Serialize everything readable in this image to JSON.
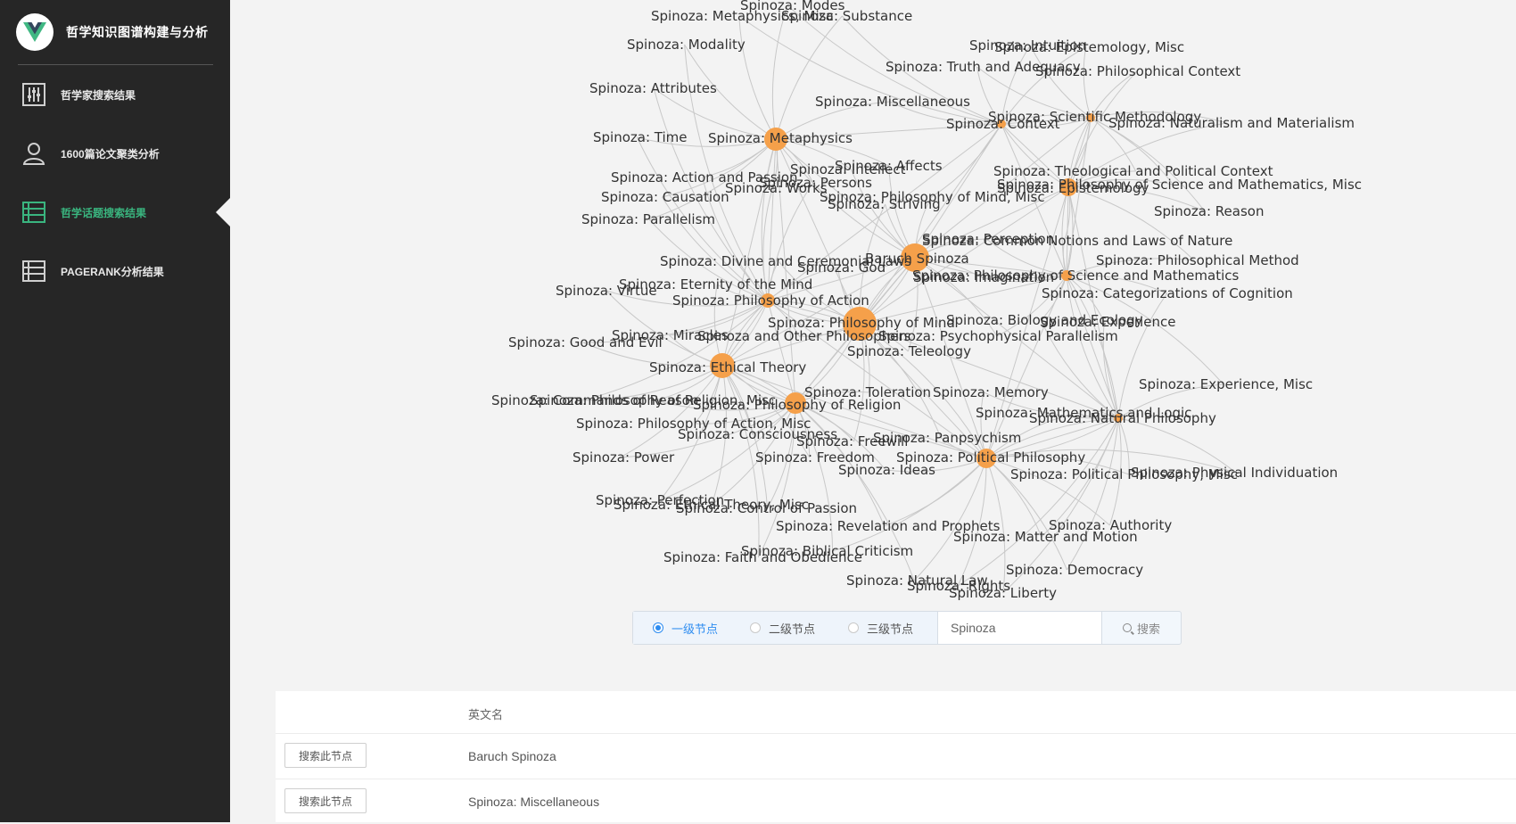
{
  "sidebar": {
    "brand_title": "哲学知识图谱构建与分析",
    "items": [
      {
        "label": "哲学家搜索结果",
        "icon": "sliders-icon",
        "active": false
      },
      {
        "label": "1600篇论文聚类分析",
        "icon": "user-icon",
        "active": false
      },
      {
        "label": "哲学话题搜索结果",
        "icon": "list-icon",
        "active": true
      },
      {
        "label": "PAGERANK分析结果",
        "icon": "list-icon",
        "active": false
      }
    ]
  },
  "colors": {
    "node": "#f5a04a",
    "edge": "#c8c8c8",
    "sidebar_bg": "#262626",
    "active": "#3ab57f",
    "radio_accent": "#2d8cf0"
  },
  "graph": {
    "nodes": [
      {
        "label": "Spinoza: Modes"
      },
      {
        "label": "Spinoza: Metaphysics, Misc"
      },
      {
        "label": "Spinoza: Substance"
      },
      {
        "label": "Spinoza: Modality"
      },
      {
        "label": "Spinoza: Intuition"
      },
      {
        "label": "Spinoza: Epistemology, Misc"
      },
      {
        "label": "Spinoza: Truth and Adequacy"
      },
      {
        "label": "Spinoza: Philosophical Context"
      },
      {
        "label": "Spinoza: Attributes"
      },
      {
        "label": "Spinoza: Miscellaneous"
      },
      {
        "label": "Spinoza: Scientific Methodology"
      },
      {
        "label": "Spinoza: Context"
      },
      {
        "label": "Spinoza: Naturalism and Materialism"
      },
      {
        "label": "Spinoza: Time"
      },
      {
        "label": "Spinoza: Metaphysics"
      },
      {
        "label": "Spinoza: Affects"
      },
      {
        "label": "Spinoza: Intellect"
      },
      {
        "label": "Spinoza: Theological and Political Context"
      },
      {
        "label": "Spinoza: Action and Passion"
      },
      {
        "label": "Spinoza: Persons"
      },
      {
        "label": "Spinoza: Philosophy of Science and Mathematics, Misc"
      },
      {
        "label": "Spinoza: Works"
      },
      {
        "label": "Spinoza: Epistemology"
      },
      {
        "label": "Spinoza: Causation"
      },
      {
        "label": "Spinoza: Philosophy of Mind, Misc"
      },
      {
        "label": "Spinoza: Striving"
      },
      {
        "label": "Spinoza: Reason"
      },
      {
        "label": "Spinoza: Parallelism"
      },
      {
        "label": "Spinoza: Perception"
      },
      {
        "label": "Spinoza: Common Notions and Laws of Nature"
      },
      {
        "label": "Spinoza: Divine and Ceremonial Laws"
      },
      {
        "label": "Baruch Spinoza"
      },
      {
        "label": "Spinoza: Philosophical Method"
      },
      {
        "label": "Spinoza: God"
      },
      {
        "label": "Spinoza: Philosophy of Science and Mathematics"
      },
      {
        "label": "Spinoza: Imagination"
      },
      {
        "label": "Spinoza: Eternity of the Mind"
      },
      {
        "label": "Spinoza: Virtue"
      },
      {
        "label": "Spinoza: Categorizations of Cognition"
      },
      {
        "label": "Spinoza: Philosophy of Action"
      },
      {
        "label": "Spinoza: Philosophy of Mind"
      },
      {
        "label": "Spinoza: Biology and Ecology"
      },
      {
        "label": "Spinoza: Experience"
      },
      {
        "label": "Spinoza: Miracles"
      },
      {
        "label": "Spinoza and Other Philosophers"
      },
      {
        "label": "Spinoza: Psychophysical Parallelism"
      },
      {
        "label": "Spinoza: Good and Evil"
      },
      {
        "label": "Spinoza: Teleology"
      },
      {
        "label": "Spinoza: Ethical Theory"
      },
      {
        "label": "Spinoza: Experience, Misc"
      },
      {
        "label": "Spinoza: Toleration"
      },
      {
        "label": "Spinoza: Memory"
      },
      {
        "label": "Spinoza: Commands of Reason"
      },
      {
        "label": "Spinoza: Philosophy of Religion, Misc"
      },
      {
        "label": "Spinoza: Philosophy of Religion"
      },
      {
        "label": "Spinoza: Mathematics and Logic"
      },
      {
        "label": "Spinoza: Natural Philosophy"
      },
      {
        "label": "Spinoza: Philosophy of Action, Misc"
      },
      {
        "label": "Spinoza: Consciousness"
      },
      {
        "label": "Spinoza: Panpsychism"
      },
      {
        "label": "Spinoza: Freewill"
      },
      {
        "label": "Spinoza: Power"
      },
      {
        "label": "Spinoza: Freedom"
      },
      {
        "label": "Spinoza: Political Philosophy"
      },
      {
        "label": "Spinoza: Ideas"
      },
      {
        "label": "Spinoza: Political Philosophy, Misc"
      },
      {
        "label": "Spinoza: Physical Individuation"
      },
      {
        "label": "Spinoza: Perfection"
      },
      {
        "label": "Spinoza: Ethical Theory, Misc"
      },
      {
        "label": "Spinoza: Control of Passion"
      },
      {
        "label": "Spinoza: Authority"
      },
      {
        "label": "Spinoza: Revelation and Prophets"
      },
      {
        "label": "Spinoza: Matter and Motion"
      },
      {
        "label": "Spinoza: Biblical Criticism"
      },
      {
        "label": "Spinoza: Faith and Obedience"
      },
      {
        "label": "Spinoza: Democracy"
      },
      {
        "label": "Spinoza: Natural Law"
      },
      {
        "label": "Spinoza: Rights"
      },
      {
        "label": "Spinoza: Liberty"
      }
    ]
  },
  "search": {
    "options": [
      "一级节点",
      "二级节点",
      "三级节点"
    ],
    "selected": 0,
    "value": "Spinoza",
    "button_label": "搜索"
  },
  "table": {
    "header": "英文名",
    "rows": [
      {
        "action": "搜索此节点",
        "name": "Baruch Spinoza"
      },
      {
        "action": "搜索此节点",
        "name": "Spinoza: Miscellaneous"
      }
    ]
  }
}
